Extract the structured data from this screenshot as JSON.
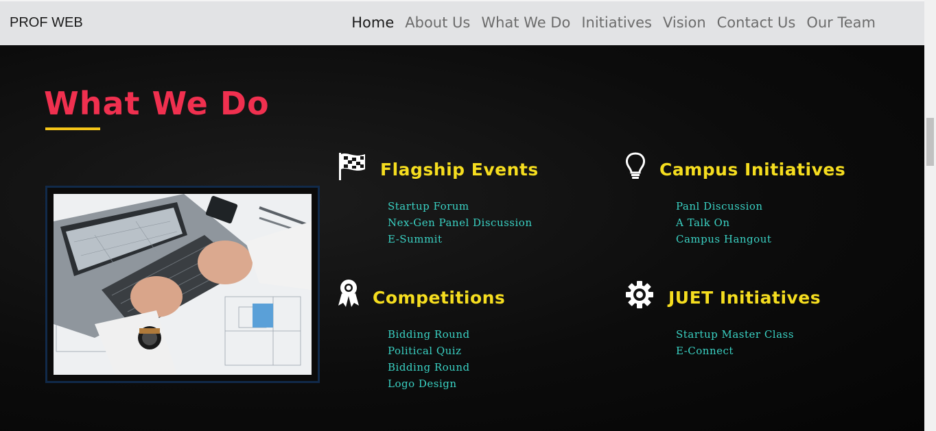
{
  "brand": "PROF WEB",
  "nav": {
    "items": [
      "Home",
      "About Us",
      "What We Do",
      "Initiatives",
      "Vision",
      "Contact Us",
      "Our Team"
    ],
    "active": "Home"
  },
  "main": {
    "title": "What We Do",
    "accent_color": "#f0304f",
    "underline_color": "#f5c518",
    "heading_color": "#f5dd1f",
    "link_color": "#3ad2c4",
    "photo_icon": "laptop-blueprint-photo",
    "sections": [
      {
        "title": "Flagship Events",
        "icon": "checkered-flag-icon",
        "items": [
          "Startup Forum",
          "Nex-Gen Panel Discussion",
          "E-Summit"
        ]
      },
      {
        "title": "Campus Initiatives",
        "icon": "lightbulb-icon",
        "items": [
          "Panl Discussion",
          "A Talk On",
          "Campus Hangout"
        ]
      },
      {
        "title": "Competitions",
        "icon": "award-ribbon-icon",
        "items": [
          "Bidding Round",
          "Political Quiz",
          "Bidding Round",
          "Logo Design"
        ]
      },
      {
        "title": "JUET Initiatives",
        "icon": "gear-icon",
        "items": [
          "Startup Master Class",
          "E-Connect"
        ]
      }
    ]
  }
}
